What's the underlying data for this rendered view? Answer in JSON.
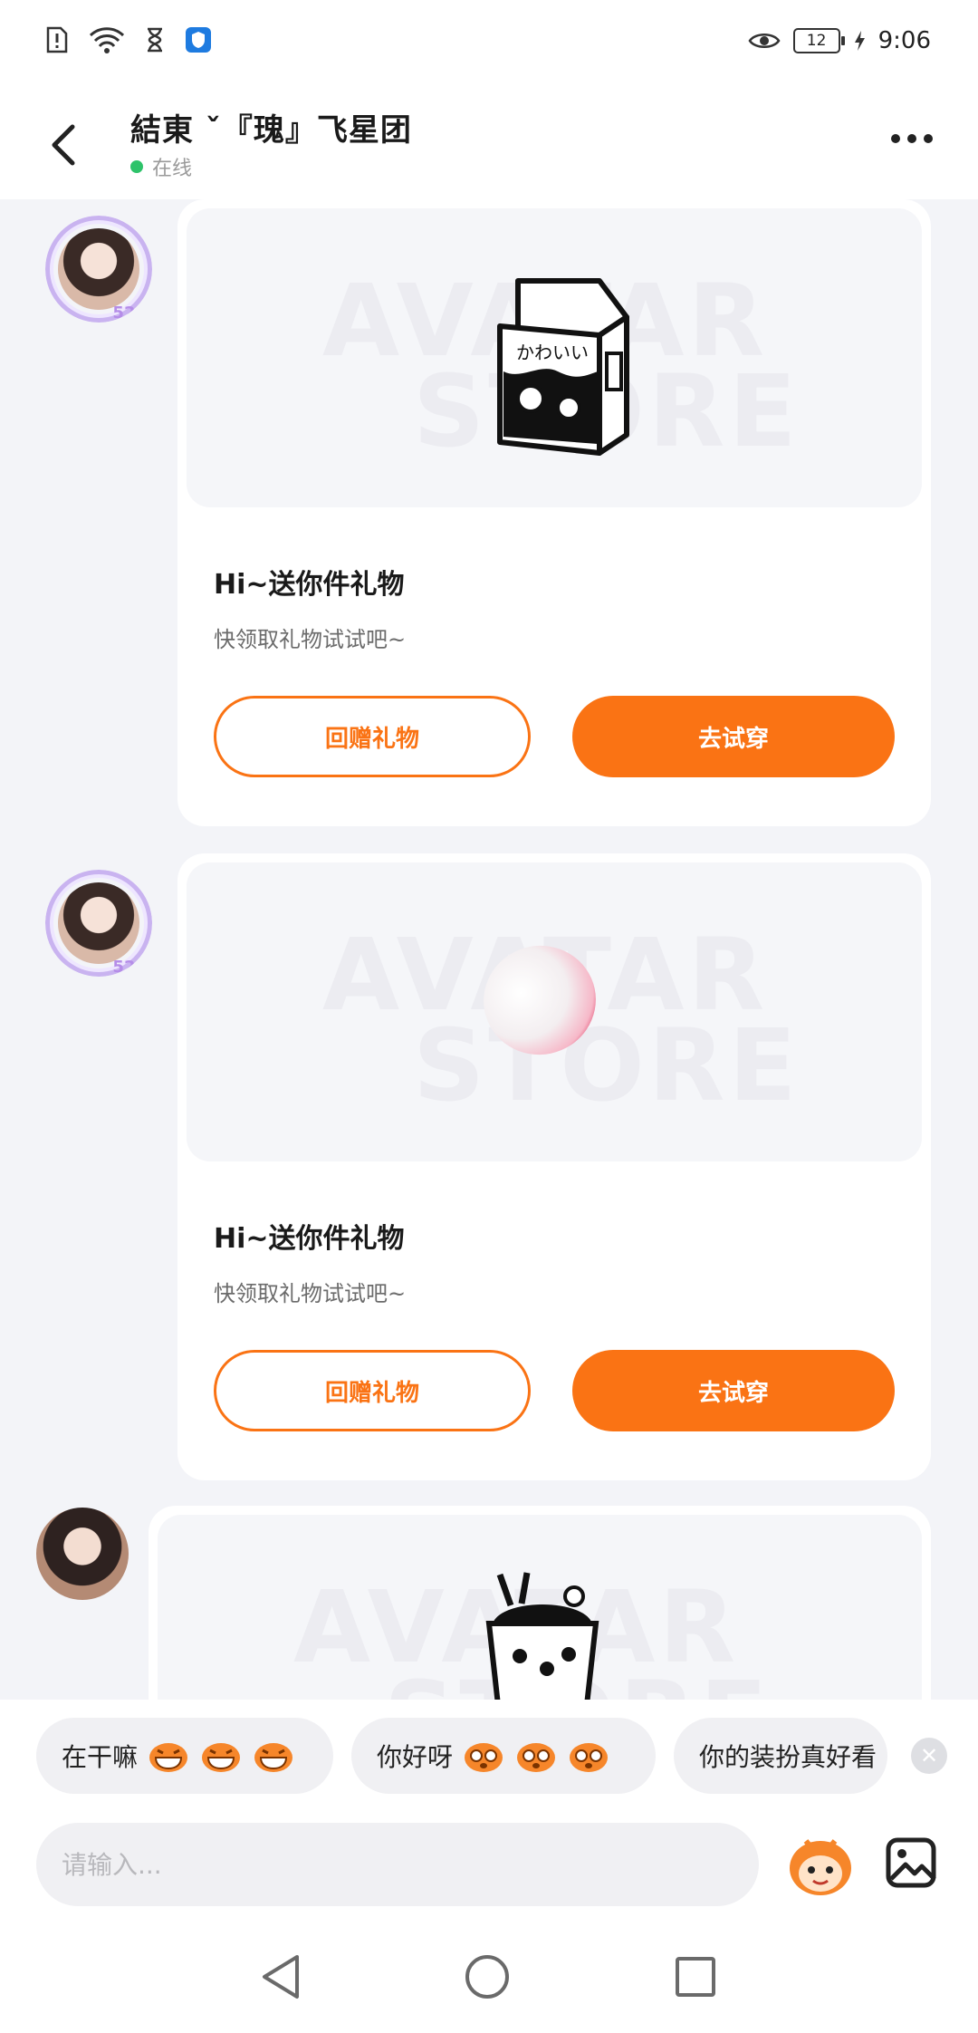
{
  "status_bar": {
    "time": "9:06",
    "battery_level": "12",
    "icons": [
      "sim-alert-icon",
      "wifi-icon",
      "hourglass-icon",
      "shield-icon",
      "eye-icon",
      "battery-icon",
      "charging-icon"
    ]
  },
  "header": {
    "title": "結東 ˇ『瑰』飞星团",
    "status": "在线"
  },
  "messages": [
    {
      "gift": "milk-carton",
      "title": "Hi~送你件礼物",
      "subtitle": "快领取礼物试试吧~",
      "return_label": "回赠礼物",
      "try_label": "去试穿"
    },
    {
      "gift": "peach",
      "title": "Hi~送你件礼物",
      "subtitle": "快领取礼物试试吧~",
      "return_label": "回赠礼物",
      "try_label": "去试穿"
    }
  ],
  "quick_replies": [
    "在干嘛",
    "你好呀",
    "你的装扮真好看"
  ],
  "input": {
    "placeholder": "请输入..."
  },
  "colors": {
    "accent": "#fa7314",
    "online": "#2ec36a",
    "background": "#f3f4f8"
  }
}
